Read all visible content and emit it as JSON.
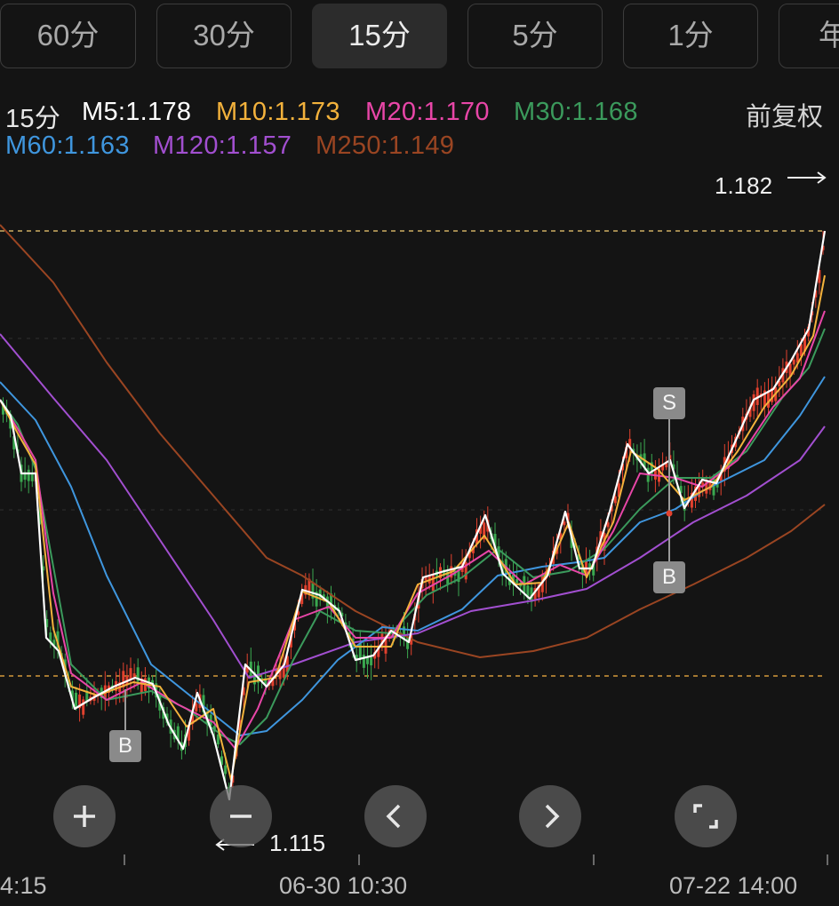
{
  "period_tabs": [
    {
      "label": "60分",
      "active": false
    },
    {
      "label": "30分",
      "active": false
    },
    {
      "label": "15分",
      "active": true
    },
    {
      "label": "5分",
      "active": false
    },
    {
      "label": "1分",
      "active": false
    },
    {
      "label": "年",
      "active": false
    }
  ],
  "legend": {
    "period": "15分",
    "ma": [
      {
        "label": "M5:1.178",
        "color": "#ffffff"
      },
      {
        "label": "M10:1.173",
        "color": "#f3b23c"
      },
      {
        "label": "M20:1.170",
        "color": "#e846a8"
      },
      {
        "label": "M30:1.168",
        "color": "#3b9a5c"
      },
      {
        "label": "M60:1.163",
        "color": "#3f96de"
      },
      {
        "label": "M120:1.157",
        "color": "#a24fd0"
      },
      {
        "label": "M250:1.149",
        "color": "#9a4522"
      }
    ],
    "adjust": "前复权"
  },
  "price_labels": {
    "high": "1.182",
    "low": "1.115"
  },
  "signals": [
    {
      "type": "B",
      "label": "B"
    },
    {
      "type": "S",
      "label": "S"
    },
    {
      "type": "B",
      "label": "B"
    }
  ],
  "x_axis": [
    "4:15",
    "06-30 10:30",
    "07-22 14:00"
  ],
  "controls": [
    {
      "name": "zoom-in",
      "icon": "plus-icon"
    },
    {
      "name": "zoom-out",
      "icon": "minus-icon"
    },
    {
      "name": "scroll-left",
      "icon": "chevron-left-icon"
    },
    {
      "name": "scroll-right",
      "icon": "chevron-right-icon"
    },
    {
      "name": "fullscreen",
      "icon": "fullscreen-icon"
    }
  ],
  "colors": {
    "up": "#e2412e",
    "down": "#3aa84f",
    "ref_line": "#e9c16a",
    "background": "#141414"
  },
  "chart_data": {
    "type": "candlestick",
    "interval": "15分",
    "max_price": 1.182,
    "min_price": 1.115,
    "ma": {
      "M5": 1.178,
      "M10": 1.173,
      "M20": 1.17,
      "M30": 1.168,
      "M60": 1.163,
      "M120": 1.157,
      "M250": 1.149
    }
  }
}
